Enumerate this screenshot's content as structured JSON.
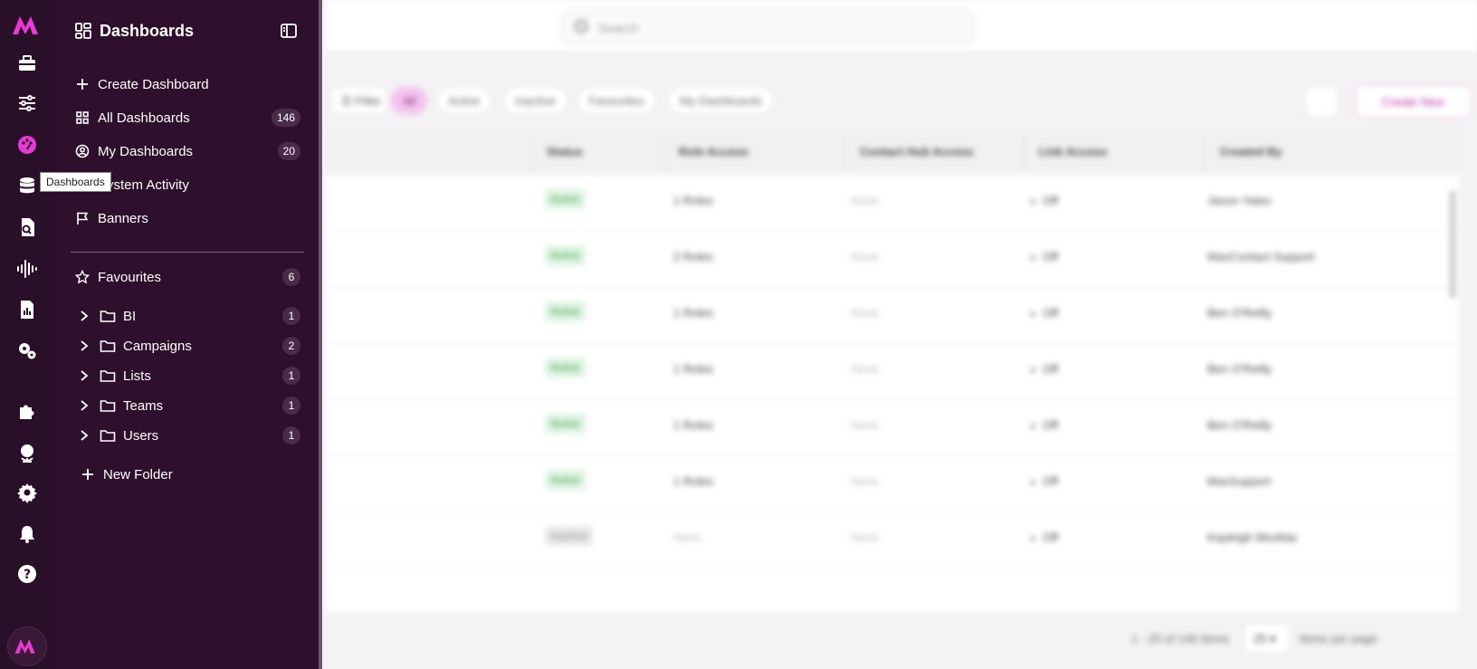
{
  "topbar": {
    "search_placeholder": "Search"
  },
  "toolbar": {
    "filter_label": "Filter",
    "chips": [
      "All",
      "Active",
      "Inactive",
      "Favourites",
      "My Dashboards"
    ],
    "create_label": "Create New"
  },
  "table": {
    "columns": [
      "Status",
      "Role Access",
      "Contact Hub Access",
      "Link Access",
      "Created By"
    ],
    "rows": [
      {
        "status": "Active",
        "role": "1 Roles",
        "hub": "None",
        "link": "Off",
        "created_by": "Jason Yates"
      },
      {
        "status": "Active",
        "role": "2 Roles",
        "hub": "None",
        "link": "Off",
        "created_by": "MaxContact Support"
      },
      {
        "status": "Active",
        "role": "1 Roles",
        "hub": "None",
        "link": "Off",
        "created_by": "Ben O'Reilly"
      },
      {
        "status": "Active",
        "role": "1 Roles",
        "hub": "None",
        "link": "Off",
        "created_by": "Ben O'Reilly"
      },
      {
        "status": "Active",
        "role": "1 Roles",
        "hub": "None",
        "link": "Off",
        "created_by": "Ben O'Reilly"
      },
      {
        "status": "Active",
        "role": "1 Roles",
        "hub": "None",
        "link": "Off",
        "created_by": "MaxSupport"
      },
      {
        "status": "Inactive",
        "role": "None",
        "hub": "None",
        "link": "Off",
        "created_by": "Kayleigh Mooklar"
      }
    ]
  },
  "footer": {
    "page_info": "1 - 25 of 146 Items",
    "page_size": "25",
    "items_per_page": "items per page"
  },
  "tooltip": "Dashboards",
  "panel": {
    "title": "Dashboards",
    "items": [
      {
        "label": "Create Dashboard",
        "icon": "plus-icon"
      },
      {
        "label": "All Dashboards",
        "icon": "grid-icon",
        "count": "146"
      },
      {
        "label": "My Dashboards",
        "icon": "user-circle-icon",
        "count": "20"
      },
      {
        "label": "System Activity",
        "icon": "monitor-icon"
      },
      {
        "label": "Banners",
        "icon": "flag-icon"
      }
    ],
    "favourites": {
      "label": "Favourites",
      "count": "6"
    },
    "folders": [
      {
        "label": "BI",
        "count": "1"
      },
      {
        "label": "Campaigns",
        "count": "2"
      },
      {
        "label": "Lists",
        "count": "1"
      },
      {
        "label": "Teams",
        "count": "1"
      },
      {
        "label": "Users",
        "count": "1"
      }
    ],
    "new_folder": "New Folder"
  },
  "rail_icons": [
    "toolbox-icon",
    "sliders-icon",
    "dashboard-palette-icon",
    "database-icon",
    "document-search-icon",
    "audio-wave-icon",
    "report-icon",
    "cogs-icon",
    "puzzle-icon",
    "globe-icon",
    "settings-icon",
    "bell-icon",
    "help-icon"
  ],
  "colors": {
    "brand": "#e43bd0",
    "panel_bg": "#2e0f2c",
    "rail_bg": "#2a0f29",
    "active_chip": "#f4c3ef"
  }
}
